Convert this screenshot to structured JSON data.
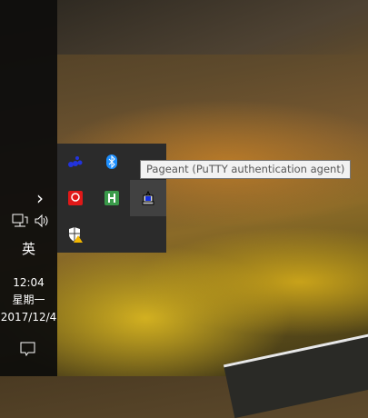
{
  "taskbar": {
    "chevron": "›",
    "language": "英",
    "time": "12:04",
    "weekday": "星期一",
    "date": "2017/12/4"
  },
  "tray_overflow": {
    "icons": [
      "dots-cluster-icon",
      "bluetooth-icon",
      "",
      "red-app-icon",
      "h-app-icon",
      "pageant-icon",
      "windows-defender-warning-icon"
    ]
  },
  "tooltip": {
    "text": "Pageant (PuTTY authentication agent)"
  }
}
